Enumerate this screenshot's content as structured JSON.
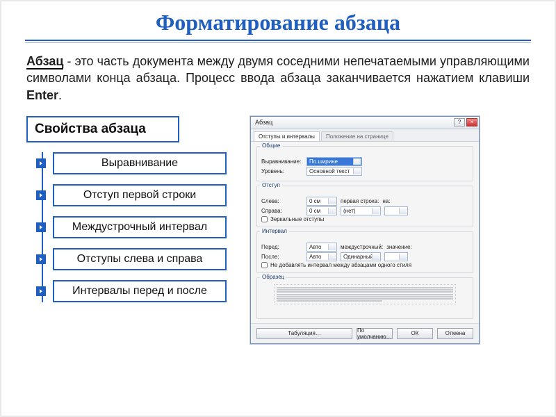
{
  "title": "Форматирование абзаца",
  "definition": {
    "word": "Абзац",
    "text1": " - это часть документа между двумя соседними непечатаемыми управляющими символами конца абзаца. Процесс ввода абзаца заканчивается нажатием клавиши ",
    "key": "Enter",
    "text2": "."
  },
  "props_header": "Свойства абзаца",
  "props": [
    "Выравнивание",
    "Отступ первой строки",
    "Междустрочный интервал",
    "Отступы слева и справа",
    "Интервалы перед и после"
  ],
  "dialog": {
    "title": "Абзац",
    "tab_active": "Отступы и интервалы",
    "tab_inactive": "Положение на странице",
    "groups": {
      "general": {
        "label": "Общие",
        "align_lbl": "Выравнивание:",
        "align_val": "По ширине",
        "level_lbl": "Уровень:",
        "level_val": "Основной текст"
      },
      "indent": {
        "label": "Отступ",
        "left_lbl": "Слева:",
        "left_val": "0 см",
        "right_lbl": "Справа:",
        "right_val": "0 см",
        "first_lbl": "первая строка:",
        "first_val": "(нет)",
        "on_lbl": "на:",
        "mirror": "Зеркальные отступы"
      },
      "spacing": {
        "label": "Интервал",
        "before_lbl": "Перед:",
        "before_val": "Авто",
        "after_lbl": "После:",
        "after_val": "Авто",
        "line_lbl": "междустрочный:",
        "line_val": "Одинарный",
        "val_lbl": "значение:",
        "nomerge": "Не добавлять интервал между абзацами одного стиля"
      },
      "preview": "Образец"
    },
    "buttons": {
      "tabs": "Табуляция…",
      "default": "По умолчанию…",
      "ok": "ОК",
      "cancel": "Отмена"
    }
  }
}
